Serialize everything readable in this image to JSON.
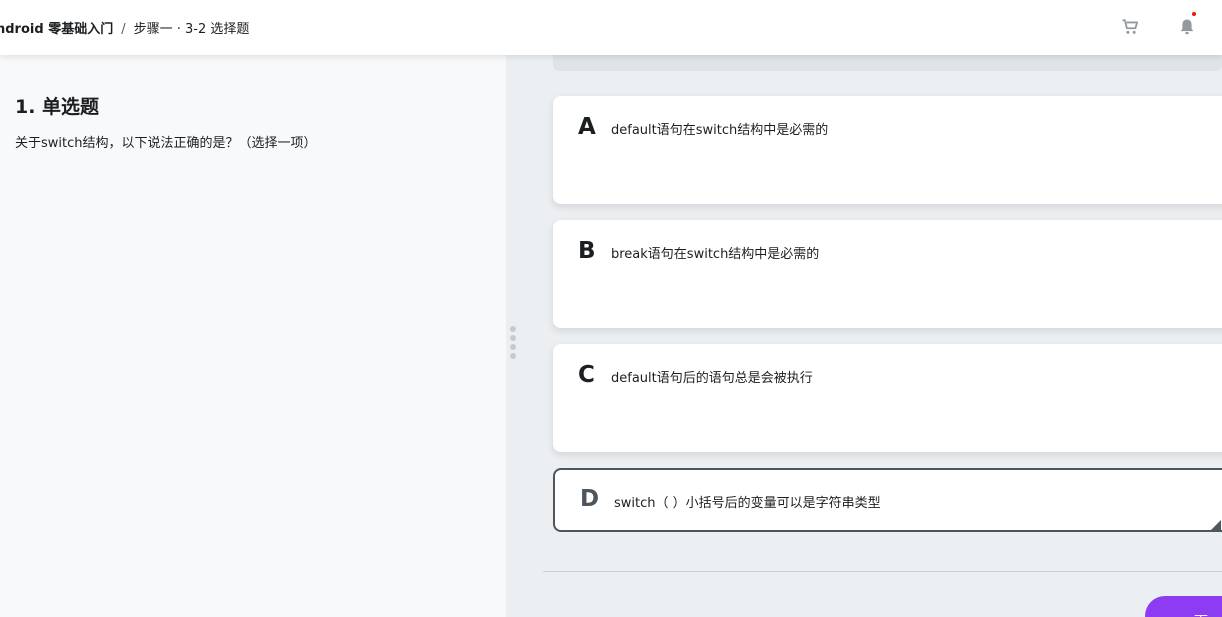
{
  "header": {
    "course": "ndroid 零基础入门",
    "separator": "/",
    "step": "步骤一 · 3-2 选择题",
    "cart_icon": "cart-icon",
    "bell_icon": "bell-icon"
  },
  "question": {
    "title": "1. 单选题",
    "text": "关于switch结构，以下说法正确的是？（选择一项）"
  },
  "options": [
    {
      "letter": "A",
      "text": "default语句在switch结构中是必需的"
    },
    {
      "letter": "B",
      "text": "break语句在switch结构中是必需的"
    },
    {
      "letter": "C",
      "text": "default语句后的语句总是会被执行"
    },
    {
      "letter": "D",
      "text": "switch（ ）小括号后的变量可以是字符串类型",
      "selected": true
    }
  ],
  "next_button": "下一节",
  "colors": {
    "accent": "#8e3bf4",
    "selected_border": "#4d555d",
    "notification_dot": "#f01414"
  }
}
